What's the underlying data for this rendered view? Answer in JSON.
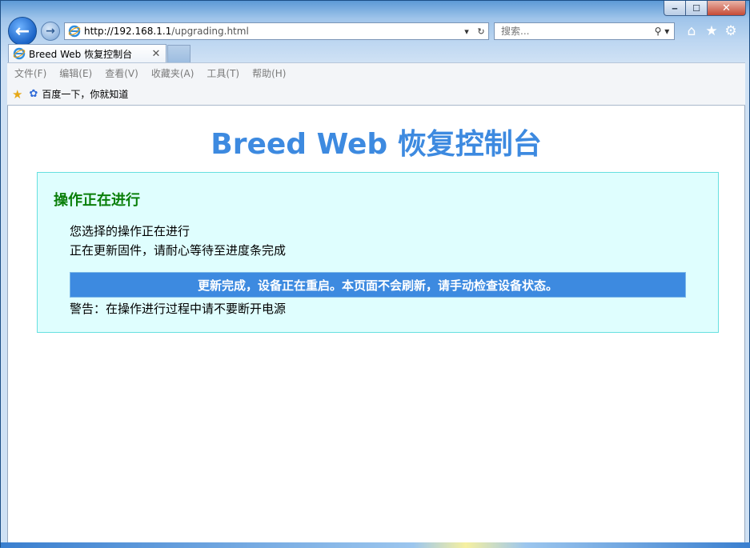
{
  "window": {
    "controls": {
      "minimize": "‒",
      "maximize": "☐",
      "close": "✕"
    }
  },
  "toolbar": {
    "back_icon": "←",
    "forward_icon": "→",
    "url_host": "http://192.168.1.1",
    "url_path": "/upgrading.html",
    "addr_dropdown": "▾",
    "addr_refresh": "↻",
    "search_placeholder": "搜索...",
    "search_icon": "⚲ ▾",
    "home_icon": "⌂",
    "favorites_icon": "★",
    "tools_icon": "⚙"
  },
  "tabs": [
    {
      "title": "Breed Web 恢复控制台",
      "close": "✕",
      "active": true
    }
  ],
  "menu": [
    "文件(F)",
    "编辑(E)",
    "查看(V)",
    "收藏夹(A)",
    "工具(T)",
    "帮助(H)"
  ],
  "favorites_bar": {
    "star_icon": "★",
    "baidu_icon": "✿",
    "link": "百度一下，你就知道"
  },
  "page": {
    "title": "Breed Web 恢复控制台",
    "panel": {
      "heading": "操作正在进行",
      "line1": "您选择的操作正在进行",
      "line2": "正在更新固件，请耐心等待至进度条完成",
      "progress": {
        "percent": 100,
        "text": "更新完成，设备正在重启。本页面不会刷新，请手动检查设备状态。"
      },
      "warning": "警告：在操作进行过程中请不要断开电源"
    }
  },
  "colors": {
    "accent": "#3d8ae0",
    "panel_bg": "#dffefe",
    "panel_border": "#67e0e0",
    "heading_green": "#0a7f0a"
  }
}
